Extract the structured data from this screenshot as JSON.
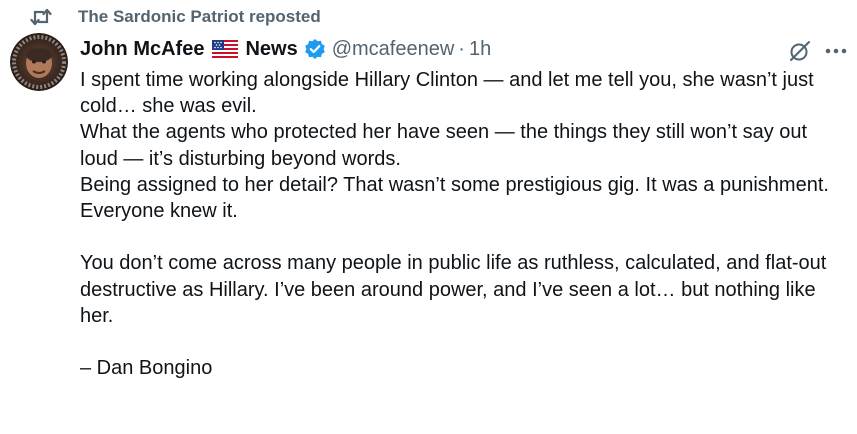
{
  "repost": {
    "icon": "repost-icon",
    "text": "The Sardonic Patriot reposted"
  },
  "author": {
    "avatar_icon": "avatar-image",
    "display_name": "John McAfee",
    "flag_icon": "us-flag-icon",
    "name_suffix": "News",
    "verified_icon": "verified-badge-icon",
    "handle": "@mcafeenew",
    "separator": "·",
    "time": "1h"
  },
  "actions": {
    "grok_icon": "grok-icon",
    "more_icon": "more-options-icon"
  },
  "tweet": {
    "line1": "I spent time working alongside Hillary Clinton — and let me tell you, she wasn’t just cold… she was evil.",
    "line2": "What the agents who protected her have seen — the things they still won’t say out loud — it’s disturbing beyond words.",
    "line3": "Being assigned to her detail? That wasn’t some prestigious gig. It was a punishment. Everyone knew it.",
    "line4": "You don’t come across many people in public life as ruthless, calculated, and flat-out destructive as Hillary. I’ve been around power, and I’ve seen a lot… but nothing like her.",
    "signature": "– Dan Bongino"
  },
  "colors": {
    "text": "#0f1419",
    "secondary": "#536471",
    "verified_blue": "#1d9bf0"
  }
}
